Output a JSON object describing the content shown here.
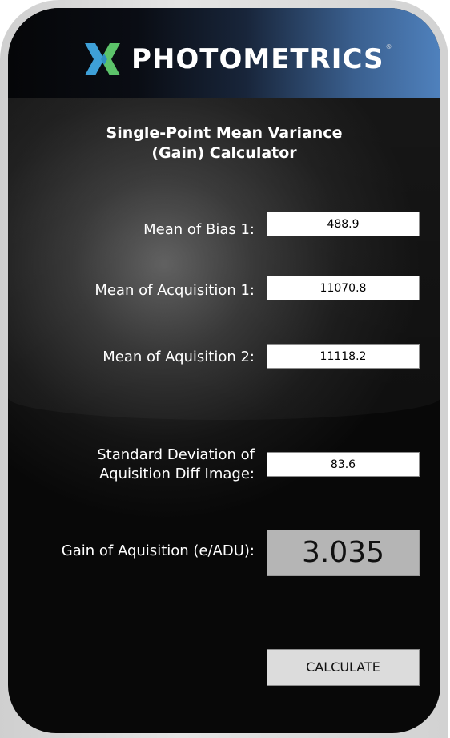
{
  "header": {
    "brand": "PHOTOMETRICS",
    "brand_mark": "®",
    "logo_icon": "photometrics-x-logo-icon",
    "colors": {
      "logo_green": "#5cc36a",
      "logo_blue": "#3ea0d8",
      "header_blue": "#4f81bd"
    }
  },
  "title": {
    "line1": "Single-Point Mean Variance",
    "line2": "(Gain) Calculator"
  },
  "fields": {
    "bias1": {
      "label": "Mean of Bias 1:",
      "value": "488.9"
    },
    "acq1": {
      "label": "Mean of Acquisition 1:",
      "value": "11070.8"
    },
    "acq2": {
      "label": "Mean of Aquisition 2:",
      "value": "11118.2"
    },
    "stddev": {
      "label_line1": "Standard Deviation of",
      "label_line2": "Aquisition Diff Image:",
      "value": "83.6"
    }
  },
  "result": {
    "label": "Gain of Aquisition (e/ADU):",
    "value": "3.035"
  },
  "actions": {
    "calculate_label": "CALCULATE"
  }
}
